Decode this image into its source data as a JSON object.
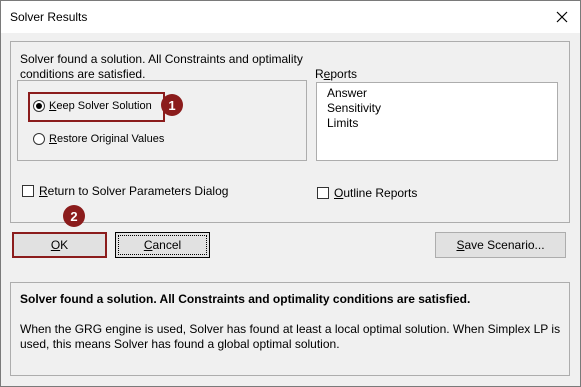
{
  "window": {
    "title": "Solver Results"
  },
  "message": "Solver found a solution.  All Constraints and optimality conditions are satisfied.",
  "options": {
    "keep": "Keep Solver Solution",
    "restore": "Restore Original Values",
    "selected": "keep"
  },
  "reports": {
    "label": "Reports",
    "items": [
      "Answer",
      "Sensitivity",
      "Limits"
    ]
  },
  "checkboxes": {
    "return_to_params": "Return to Solver Parameters Dialog",
    "outline_reports": "Outline Reports"
  },
  "buttons": {
    "ok": "OK",
    "cancel": "Cancel",
    "save_scenario": "Save Scenario..."
  },
  "badges": {
    "one": "1",
    "two": "2"
  },
  "details": {
    "title": "Solver found a solution.  All Constraints and optimality conditions are satisfied.",
    "body": "When the GRG engine is used, Solver has found at least a local optimal solution. When Simplex LP is used, this means Solver has found a global optimal solution."
  },
  "colors": {
    "highlight": "#8b1c1c",
    "dialog_bg": "#f0f0f0"
  },
  "icons": {
    "close": "close-icon"
  }
}
